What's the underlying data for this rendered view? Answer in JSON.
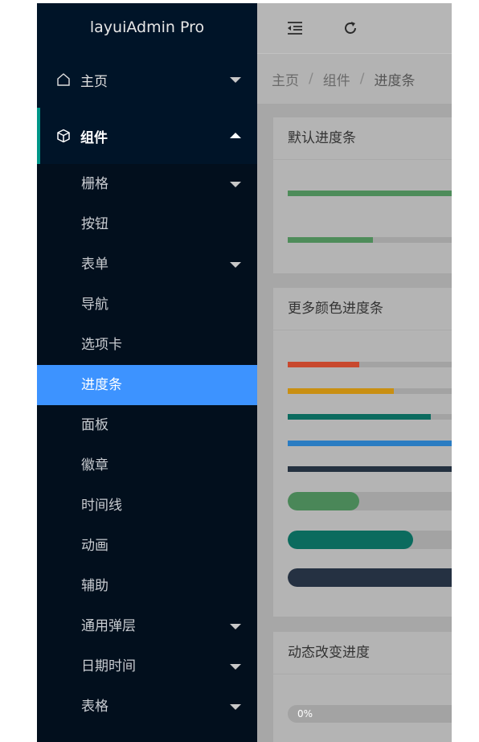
{
  "sidebar": {
    "logo": "layuiAdmin Pro",
    "home": {
      "label": "主页",
      "icon": "home-icon"
    },
    "components": {
      "label": "组件",
      "icon": "box-icon"
    },
    "subitems": [
      {
        "label": "栅格",
        "arrow": true
      },
      {
        "label": "按钮",
        "arrow": false
      },
      {
        "label": "表单",
        "arrow": true
      },
      {
        "label": "导航",
        "arrow": false
      },
      {
        "label": "选项卡",
        "arrow": false
      },
      {
        "label": "进度条",
        "arrow": false,
        "selected": true
      },
      {
        "label": "面板",
        "arrow": false
      },
      {
        "label": "徽章",
        "arrow": false
      },
      {
        "label": "时间线",
        "arrow": false
      },
      {
        "label": "动画",
        "arrow": false
      },
      {
        "label": "辅助",
        "arrow": false
      },
      {
        "label": "通用弹层",
        "arrow": true
      },
      {
        "label": "日期时间",
        "arrow": true
      },
      {
        "label": "表格",
        "arrow": true
      }
    ]
  },
  "topbar": {
    "icons": [
      "indent-icon",
      "refresh-icon"
    ]
  },
  "breadcrumb": {
    "items": [
      "主页",
      "组件",
      "进度条"
    ],
    "separator": "/"
  },
  "cards": {
    "default": {
      "title": "默认进度条",
      "bars": [
        {
          "percent": 100,
          "color": "#4e8c5a"
        },
        {
          "percent": 44,
          "color": "#4e8c5a"
        }
      ]
    },
    "colors": {
      "title": "更多颜色进度条",
      "bars": [
        {
          "percent": 37,
          "color": "#c8482e"
        },
        {
          "percent": 55,
          "color": "#c98f12"
        },
        {
          "percent": 74,
          "color": "#0c6b5f"
        },
        {
          "percent": 100,
          "color": "#2a7cc2"
        },
        {
          "percent": 100,
          "color": "#243140"
        },
        {
          "percent": 37,
          "color": "#4a8758",
          "big": true
        },
        {
          "percent": 65,
          "color": "#0b6b5e",
          "big": true
        },
        {
          "percent": 100,
          "color": "#253142",
          "big": true
        }
      ]
    },
    "dynamic": {
      "title": "动态改变进度",
      "bar": {
        "percent": 0,
        "label": "0%"
      }
    }
  }
}
